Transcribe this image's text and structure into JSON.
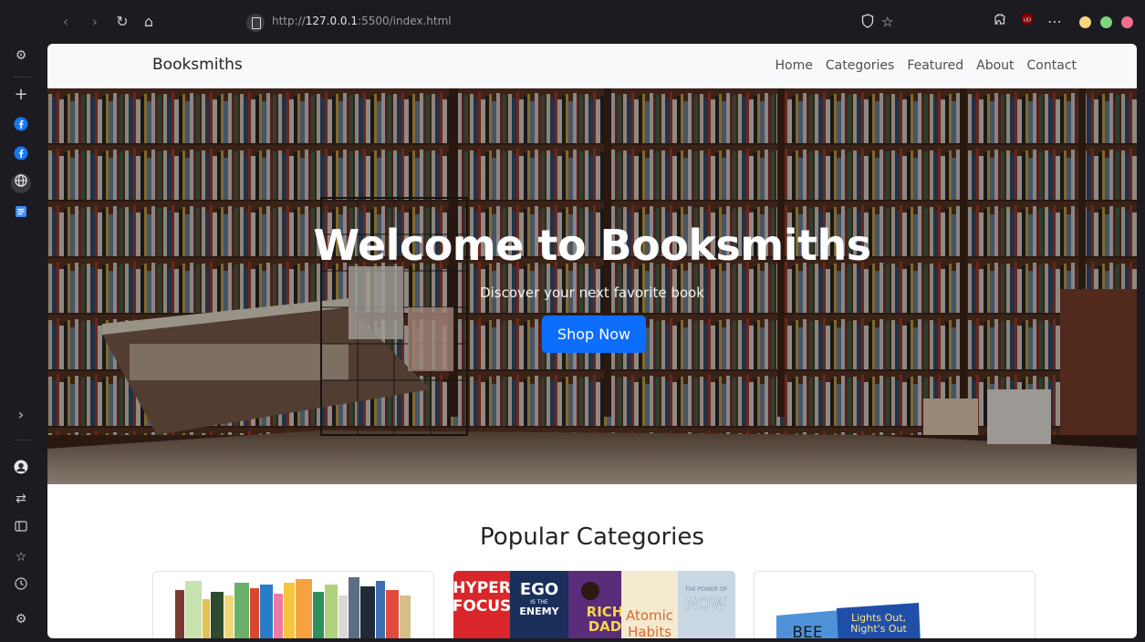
{
  "browser": {
    "url_prefix": "http://",
    "url_host": "127.0.0.1",
    "url_rest": ":5500/index.html",
    "extension_badge": "UD"
  },
  "site": {
    "brand": "Booksmiths",
    "nav": [
      "Home",
      "Categories",
      "Featured",
      "About",
      "Contact"
    ]
  },
  "hero": {
    "title": "Welcome to Booksmiths",
    "subtitle": "Discover your next favorite book",
    "button": "Shop Now"
  },
  "categories": {
    "title": "Popular Categories"
  },
  "book_cover_texts": {
    "ego_line1": "EGO",
    "ego_line2": "IS THE",
    "ego_line3": "ENEMY",
    "hyper_line1": "HYPER",
    "hyper_line2": "FOCUS",
    "rich_line1": "RICH",
    "rich_line2": "DAD",
    "atomic_line1": "Atomic",
    "atomic_line2": "Habits",
    "now_line1": "THE POWER OF",
    "now_line2": "NOW",
    "kids_line1": "BEE",
    "kids_line2": "Lights Out,",
    "kids_line3": "Night's Out"
  },
  "colors": {
    "primary": "#0d6efd",
    "navbar_bg": "#f8f9fa",
    "traffic_yellow": "#f9d67a",
    "traffic_green": "#7cd47c",
    "traffic_red": "#f36f8b"
  }
}
